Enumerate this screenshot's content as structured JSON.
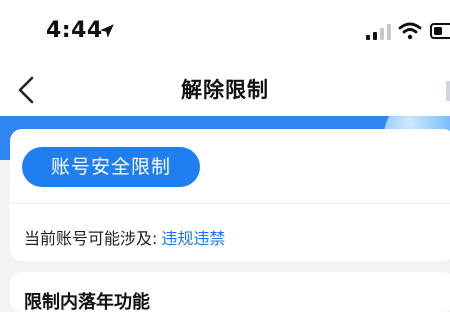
{
  "status_bar": {
    "time": "4:44",
    "icons": [
      "location-arrow-icon",
      "signal-icon",
      "wifi-icon",
      "battery-icon"
    ]
  },
  "nav": {
    "title": "解除限制",
    "back_icon": "chevron-left-icon"
  },
  "card": {
    "restriction_type": "账号安全限制",
    "current_prefix": "当前账号可能涉及:",
    "violation_link": "违规违禁"
  },
  "bottom_card": {
    "title": "限制内落年功能"
  },
  "colors": {
    "accent": "#1f7ef0",
    "link": "#1f76e5",
    "hero": "#2d86f1",
    "background": "#f2f3f5"
  }
}
